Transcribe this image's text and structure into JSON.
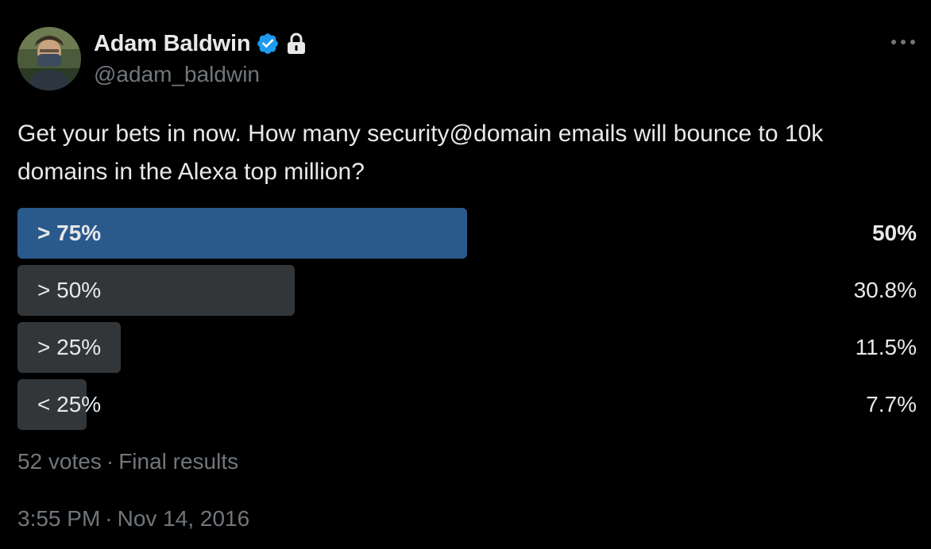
{
  "author": {
    "display_name": "Adam Baldwin",
    "handle": "@adam_baldwin",
    "avatar_icon": "user-avatar",
    "verified_icon": "verified-badge-icon",
    "protected_icon": "lock-icon"
  },
  "more_icon": "more-horizontal-icon",
  "tweet": {
    "text": "Get your bets in now. How many security@domain emails will bounce to 10k domains in the Alexa top million?"
  },
  "poll": {
    "options": [
      {
        "label": "> 75%",
        "percent_text": "50%",
        "percent": 50,
        "winner": true
      },
      {
        "label": "> 50%",
        "percent_text": "30.8%",
        "percent": 30.8,
        "winner": false
      },
      {
        "label": "> 25%",
        "percent_text": "11.5%",
        "percent": 11.5,
        "winner": false
      },
      {
        "label": "< 25%",
        "percent_text": "7.7%",
        "percent": 7.7,
        "winner": false
      }
    ],
    "votes": "52 votes",
    "status": "Final results"
  },
  "timestamp": {
    "time": "3:55 PM",
    "date": "Nov 14, 2016"
  },
  "colors": {
    "background": "#000000",
    "text": "#e7e9ea",
    "secondary_text": "#71767b",
    "winner_bar": "#2a5a8c",
    "bar": "#333639",
    "verified": "#1d9bf0"
  }
}
